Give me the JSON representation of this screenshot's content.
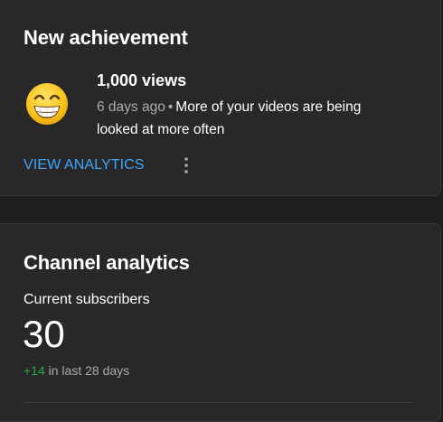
{
  "achievement": {
    "title": "New achievement",
    "heading": "1,000 views",
    "time": "6 days ago",
    "separator": "•",
    "description": "More of your videos are being looked at more often",
    "action_label": "VIEW ANALYTICS",
    "emoji_icon": "grinning-face-icon",
    "more_icon": "more-vertical-icon"
  },
  "analytics": {
    "title": "Channel analytics",
    "subscribers_label": "Current subscribers",
    "subscribers_count": "30",
    "change_value": "+14",
    "change_period": "in last 28 days"
  },
  "colors": {
    "background": "#1f1f1f",
    "card": "#282828",
    "link": "#3ea6ff",
    "positive": "#2ba640",
    "secondary_text": "#aaaaaa"
  }
}
